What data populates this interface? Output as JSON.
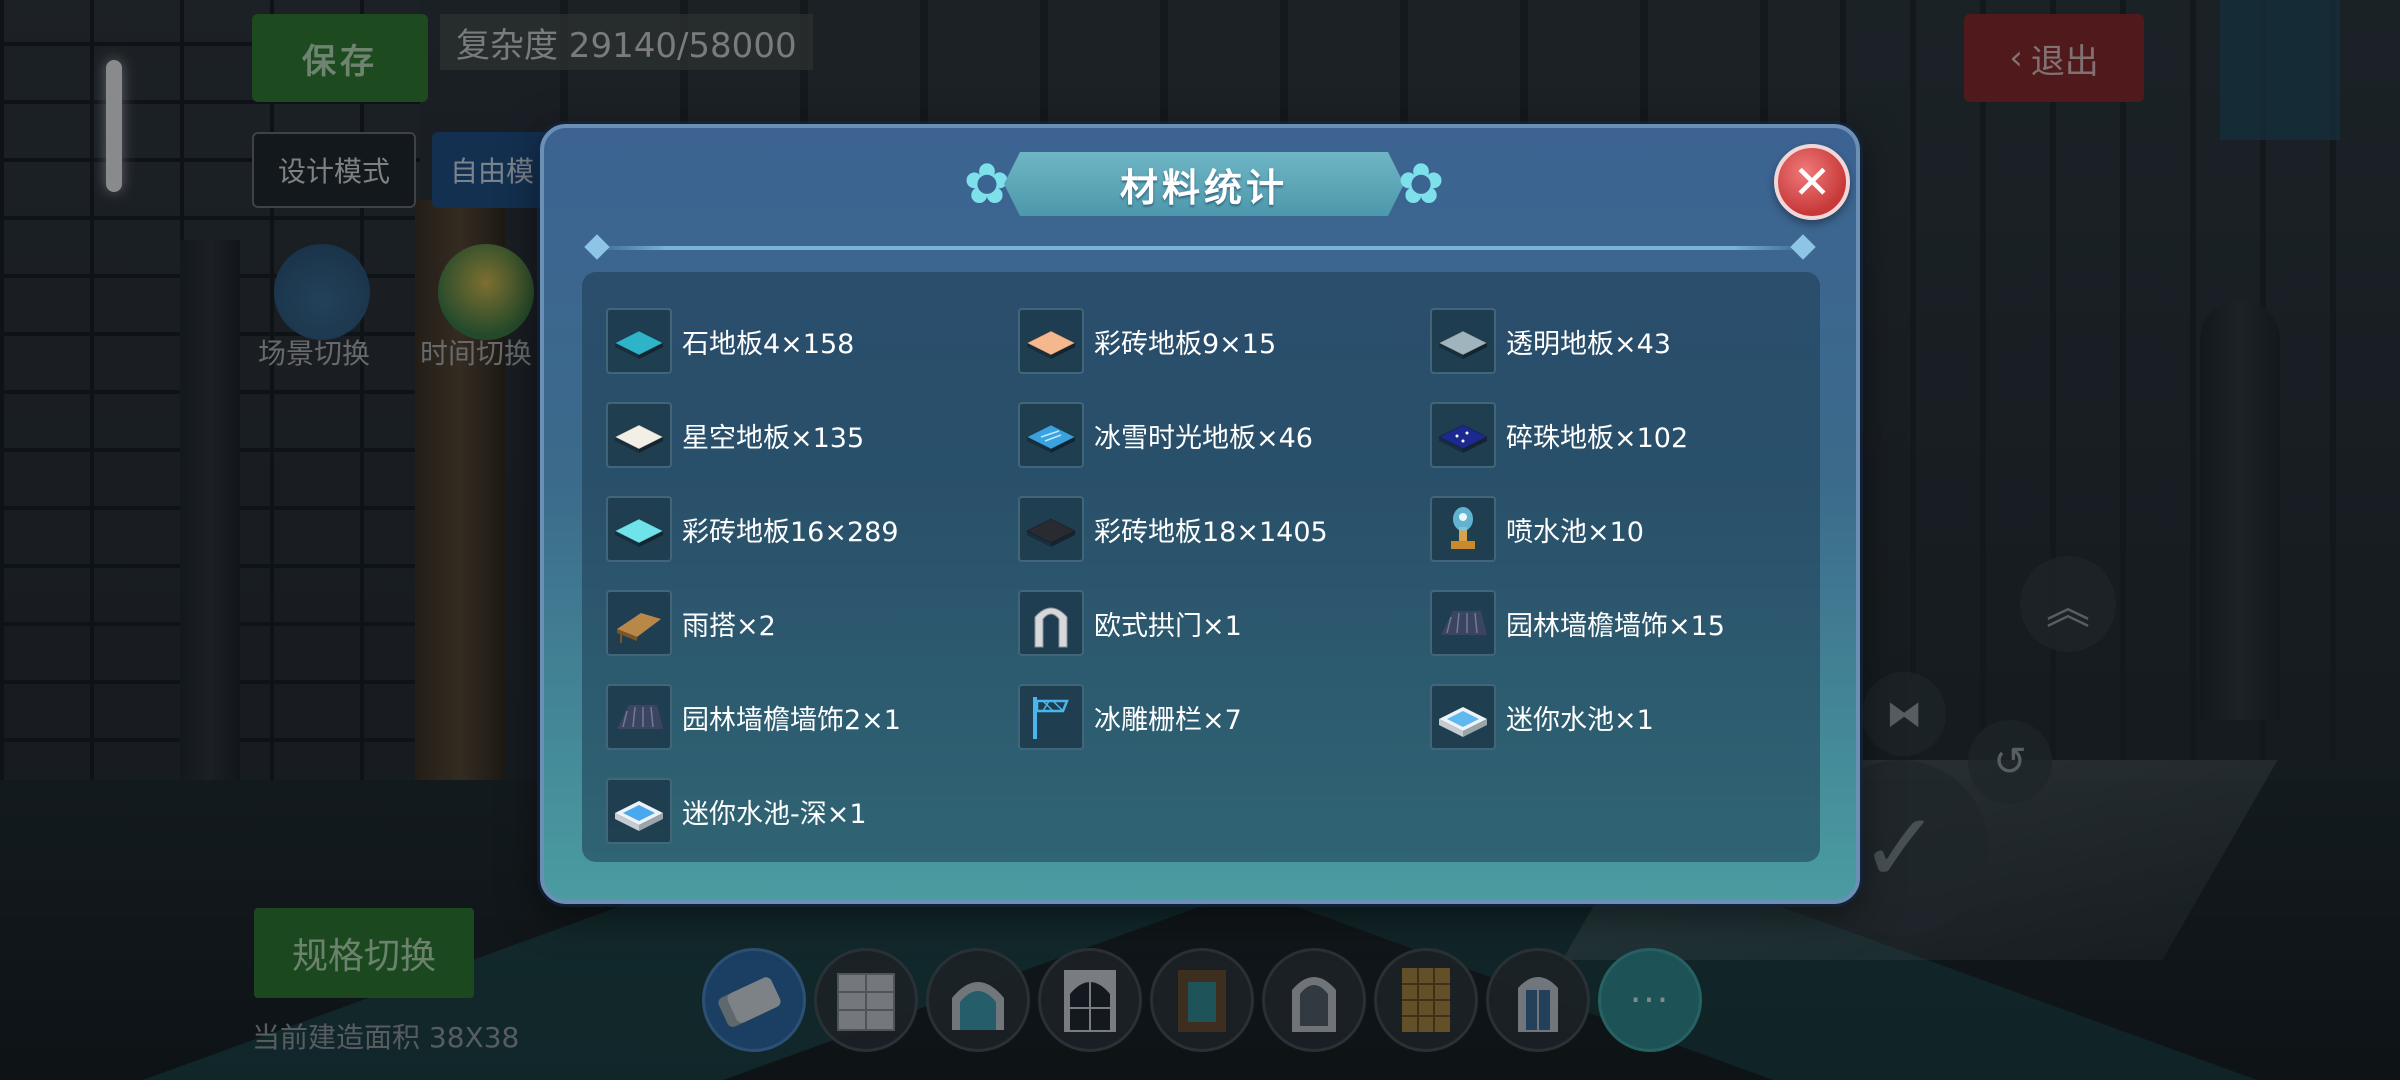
{
  "hud": {
    "save_label": "保存",
    "complexity_text": "复杂度 29140/58000",
    "exit_label": "退出",
    "design_mode_label": "设计模式",
    "free_mode_label": "自由模",
    "scene_switch_label": "场景切换",
    "time_switch_label": "时间切换",
    "spec_switch_label": "规格切换",
    "build_area_text": "当前建造面积 38X38",
    "more_label": "···"
  },
  "modal": {
    "title": "材料统计",
    "close_symbol": "✕",
    "items": [
      {
        "name": "石地板4×158",
        "icon": "stone-floor-icon",
        "color": "#2fb3c9"
      },
      {
        "name": "彩砖地板9×15",
        "icon": "color-tile-floor-icon",
        "color": "#f4b78e"
      },
      {
        "name": "透明地板×43",
        "icon": "transparent-floor-icon",
        "color": "#9fb4bc"
      },
      {
        "name": "星空地板×135",
        "icon": "starry-floor-icon",
        "color": "#f2efe6"
      },
      {
        "name": "冰雪时光地板×46",
        "icon": "ice-snow-floor-icon",
        "color": "#3aa2de"
      },
      {
        "name": "碎珠地板×102",
        "icon": "bead-floor-icon",
        "color": "#1c2a8f"
      },
      {
        "name": "彩砖地板16×289",
        "icon": "color-tile-floor-icon",
        "color": "#6fe3ea"
      },
      {
        "name": "彩砖地板18×1405",
        "icon": "color-tile-floor-icon",
        "color": "#2a2b30"
      },
      {
        "name": "喷水池×10",
        "icon": "fountain-icon",
        "color": "#6fc8e6"
      },
      {
        "name": "雨搭×2",
        "icon": "awning-icon",
        "color": "#b88848"
      },
      {
        "name": "欧式拱门×1",
        "icon": "arch-door-icon",
        "color": "#d6d8dc"
      },
      {
        "name": "园林墙檐墙饰×15",
        "icon": "wall-eave-icon",
        "color": "#3c4560"
      },
      {
        "name": "园林墙檐墙饰2×1",
        "icon": "wall-eave-icon",
        "color": "#3c4560"
      },
      {
        "name": "冰雕栅栏×7",
        "icon": "ice-fence-icon",
        "color": "#4bb6ee"
      },
      {
        "name": "迷你水池×1",
        "icon": "mini-pool-icon",
        "color": "#5fb8f0"
      },
      {
        "name": "迷你水池-深×1",
        "icon": "deep-mini-pool-icon",
        "color": "#4aa8ee"
      }
    ]
  },
  "toolbar": {
    "slots": [
      {
        "icon": "eraser-icon"
      },
      {
        "icon": "cabinet-icon"
      },
      {
        "icon": "arched-window-icon"
      },
      {
        "icon": "gothic-window-icon"
      },
      {
        "icon": "door-frame-icon"
      },
      {
        "icon": "arch-window-icon"
      },
      {
        "icon": "lattice-panel-icon"
      },
      {
        "icon": "blue-door-icon"
      }
    ]
  }
}
